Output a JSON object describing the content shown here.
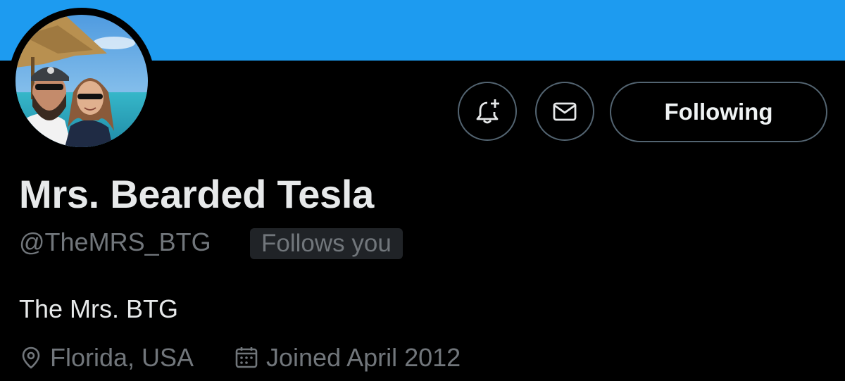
{
  "profile": {
    "display_name": "Mrs. Bearded Tesla",
    "handle": "@TheMRS_BTG",
    "follows_badge": "Follows you",
    "bio": "The Mrs. BTG",
    "location": "Florida, USA",
    "joined": "Joined April 2012"
  },
  "actions": {
    "following_label": "Following",
    "notify_icon": "bell-plus-icon",
    "message_icon": "envelope-icon"
  },
  "colors": {
    "banner": "#1d9bf0",
    "background": "#000000",
    "secondary_text": "#71767b",
    "border": "#536471"
  }
}
